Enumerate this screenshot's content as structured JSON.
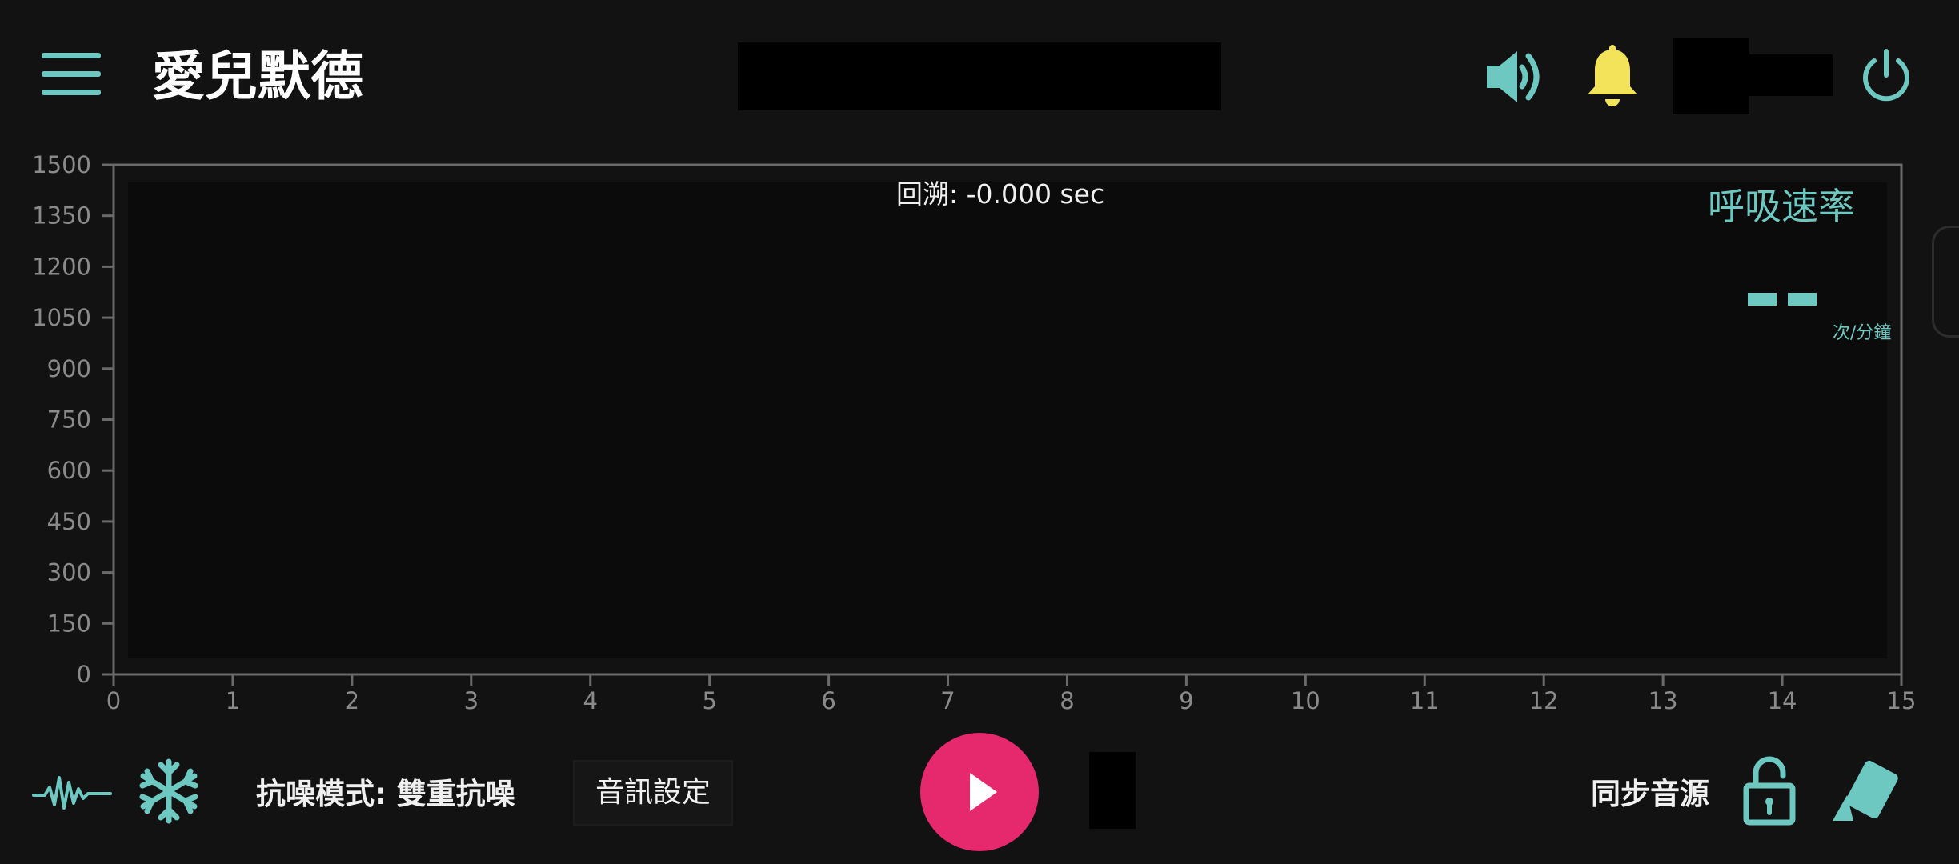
{
  "header": {
    "app_title": "愛兒默德",
    "icons": [
      "menu-icon",
      "speaker-icon",
      "bell-icon",
      "power-icon"
    ]
  },
  "chart_data": {
    "type": "line",
    "x_ticks": [
      "0",
      "1",
      "2",
      "3",
      "4",
      "5",
      "6",
      "7",
      "8",
      "9",
      "10",
      "11",
      "12",
      "13",
      "14",
      "15"
    ],
    "y_ticks": [
      "0",
      "150",
      "300",
      "450",
      "600",
      "750",
      "900",
      "1050",
      "1200",
      "1350",
      "1500"
    ],
    "xlim": [
      0,
      15
    ],
    "ylim": [
      0,
      1500
    ],
    "series": [],
    "annotation": "回溯: -0.000 sec",
    "grid": false
  },
  "vital": {
    "title": "呼吸速率",
    "value": "--",
    "unit": "次/分鐘"
  },
  "footer": {
    "noise_mode_label": "抗噪模式: 雙重抗噪",
    "audio_settings_label": "音訊設定",
    "sync_label": "同步音源",
    "icons": [
      "waveform-icon",
      "snowflake-icon",
      "play-icon",
      "unlock-icon",
      "eraser-icon"
    ]
  },
  "colors": {
    "accent": "#6cc8c0",
    "bell": "#f3e35a",
    "play": "#e6296d",
    "background": "#121212",
    "plot_area": "#0b0b0b"
  }
}
